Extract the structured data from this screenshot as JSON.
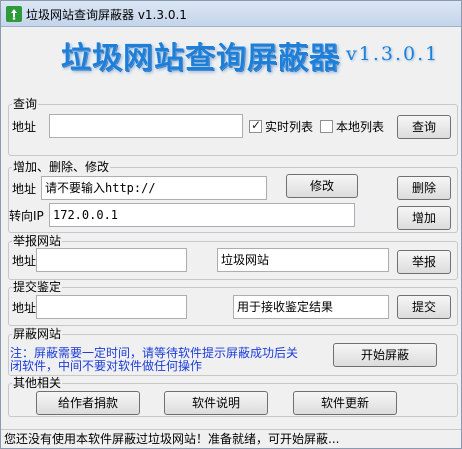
{
  "window": {
    "title": "垃圾网站查询屏蔽器 v1.3.0.1"
  },
  "banner": {
    "title": "垃圾网站查询屏蔽器",
    "version": "v1.3.0.1"
  },
  "query": {
    "group_label": "查询",
    "address_label": "地址",
    "address_value": "",
    "realtime_label": "实时列表",
    "realtime_checked": true,
    "local_label": "本地列表",
    "local_checked": false,
    "query_button": "查询"
  },
  "edit": {
    "group_label": "增加、删除、修改",
    "address_label": "地址",
    "address_placeholder": "请不要输入http://",
    "modify_button": "修改",
    "delete_button": "删除",
    "redirect_label": "转向IP",
    "redirect_value": "172.0.0.1",
    "add_button": "增加"
  },
  "report": {
    "group_label": "举报网站",
    "address_label": "地址",
    "address_value": "",
    "type_value": "垃圾网站",
    "report_button": "举报"
  },
  "submit": {
    "group_label": "提交鉴定",
    "address_label": "地址",
    "address_value": "",
    "result_value": "用于接收鉴定结果",
    "submit_button": "提交"
  },
  "block": {
    "group_label": "屏蔽网站",
    "note_line1": "注：屏蔽需要一定时间，请等待软件提示屏蔽成功后关",
    "note_line2": "闭软件，中间不要对软件做任何操作",
    "start_button": "开始屏蔽"
  },
  "other": {
    "group_label": "其他相关",
    "donate_button": "给作者捐款",
    "help_button": "软件说明",
    "update_button": "软件更新"
  },
  "status": {
    "text": "您还没有使用本软件屏蔽过垃圾网站！准备就绪，可开始屏蔽..."
  },
  "colors": {
    "banner_blue": "#1e7fd8",
    "note_blue": "#1a3cd8"
  },
  "icons": {
    "app": "recycle-icon"
  }
}
